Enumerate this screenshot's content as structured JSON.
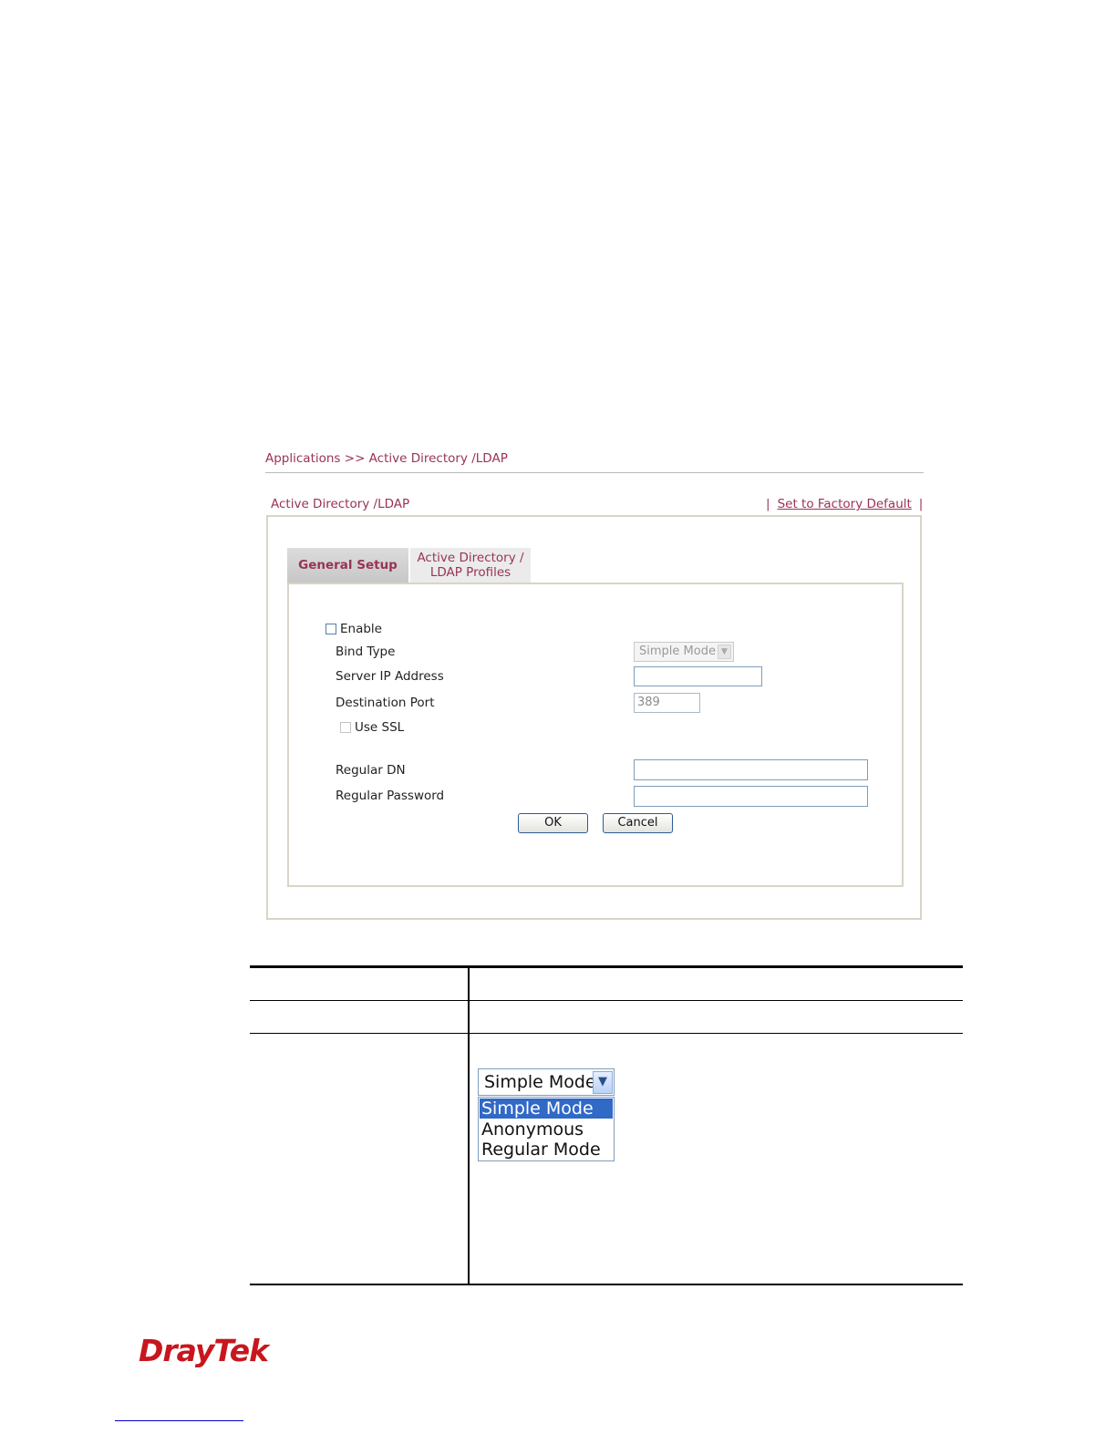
{
  "breadcrumb": "Applications >> Active Directory /LDAP",
  "panel_title": "Active Directory /LDAP",
  "factory_sep": "|",
  "factory_link": "Set to Factory Default",
  "tabs": {
    "general": "General Setup",
    "profiles_line1": "Active Directory /",
    "profiles_line2": "LDAP Profiles"
  },
  "form": {
    "enable_label": "Enable",
    "bind_type_label": "Bind Type",
    "bind_type_value": "Simple Mode",
    "server_ip_label": "Server IP Address",
    "server_ip_value": "",
    "dest_port_label": "Destination Port",
    "dest_port_value": "389",
    "use_ssl_label": "Use SSL",
    "regular_dn_label": "Regular DN",
    "regular_password_label": "Regular Password",
    "ok_label": "OK",
    "cancel_label": "Cancel"
  },
  "dropdown": {
    "value": "Simple Mode",
    "options": [
      "Simple Mode",
      "Anonymous",
      "Regular Mode"
    ],
    "selected_index": 0
  },
  "logo": "DrayTek",
  "colors": {
    "accent": "#993355",
    "logo": "#c8161d",
    "selection": "#3169c6"
  }
}
